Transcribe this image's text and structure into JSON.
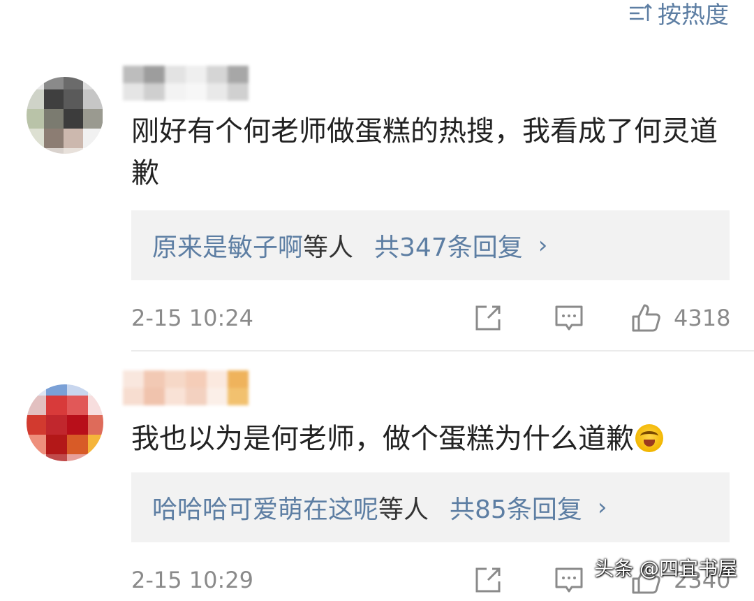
{
  "sort": {
    "label": "按热度"
  },
  "comments": [
    {
      "content": "刚好有个何老师做蛋糕的热搜，我看成了何灵道歉",
      "reply_names": "原来是敏子啊",
      "reply_etc": "等人",
      "reply_count": "共347条回复",
      "time": "2-15 10:24",
      "likes": "4318"
    },
    {
      "content": "我也以为是何老师，做个蛋糕为什么道歉",
      "reply_names": "哈哈哈可爱萌在这呢",
      "reply_etc": "等人",
      "reply_count": "共85条回复",
      "time": "2-15 10:29",
      "likes": "2340"
    }
  ],
  "watermark": "头条 @四宜书屋",
  "colors": {
    "link": "#5d7ea3",
    "text": "#222222",
    "meta": "#8a8a8a",
    "reply_bg": "#f2f2f2"
  }
}
